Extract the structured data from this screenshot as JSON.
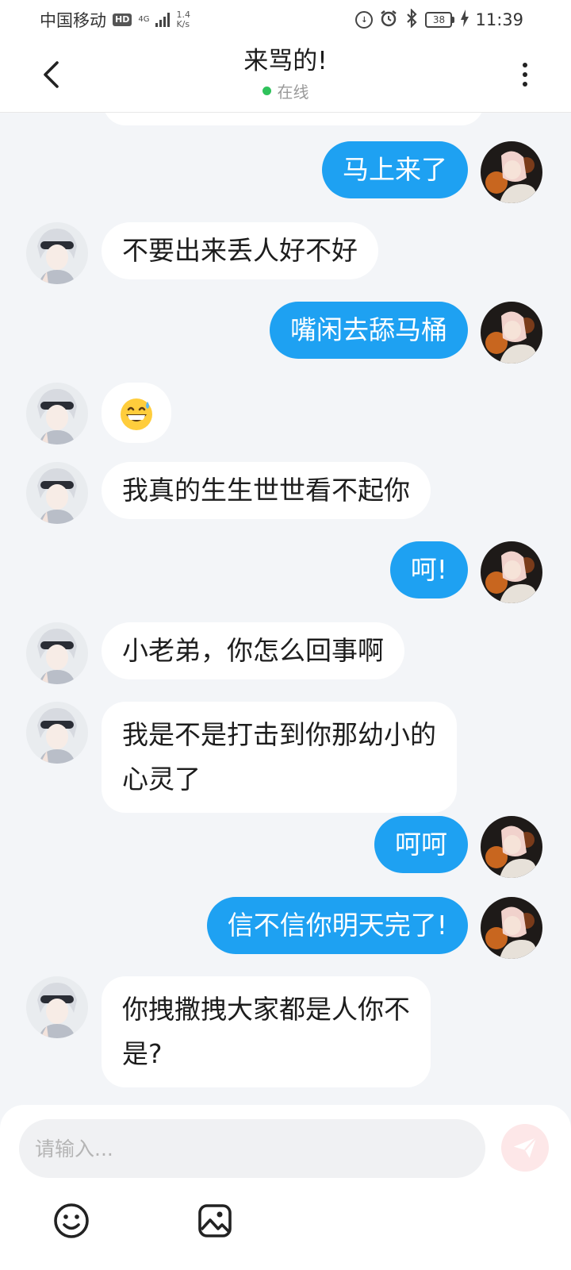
{
  "status_bar": {
    "carrier": "中国移动",
    "hd": "HD",
    "network": "4G",
    "speed_value": "1.4",
    "speed_unit": "K/s",
    "battery": "38",
    "time": "11:39"
  },
  "header": {
    "title": "来骂的!",
    "presence": "在线"
  },
  "messages": [
    {
      "side": "outgoing",
      "text": "马上来了"
    },
    {
      "side": "incoming",
      "text": "不要出来丢人好不好"
    },
    {
      "side": "outgoing",
      "text": "嘴闲去舔马桶"
    },
    {
      "side": "incoming",
      "text": "",
      "emoji": "grinning-sweat-face"
    },
    {
      "side": "incoming",
      "text": "我真的生生世世看不起你"
    },
    {
      "side": "outgoing",
      "text": "呵!"
    },
    {
      "side": "incoming",
      "text": "小老弟，你怎么回事啊"
    },
    {
      "side": "incoming",
      "text": "我是不是打击到你那幼小的\n心灵了"
    },
    {
      "side": "outgoing",
      "text": "呵呵"
    },
    {
      "side": "outgoing",
      "text": "信不信你明天完了!"
    },
    {
      "side": "incoming",
      "text": "你拽撒拽大家都是人你不\n是?"
    }
  ],
  "composer": {
    "placeholder": "请输入...",
    "value": ""
  },
  "colors": {
    "outgoing_bubble": "#1ea1f2",
    "incoming_bubble": "#ffffff",
    "background": "#f3f5f8",
    "online": "#2fc25b",
    "send_button": "#fde7e8"
  },
  "icons": {
    "back": "chevron-left-icon",
    "more": "more-vertical-icon",
    "send": "send-icon",
    "emoji": "emoji-icon",
    "image": "image-icon"
  }
}
